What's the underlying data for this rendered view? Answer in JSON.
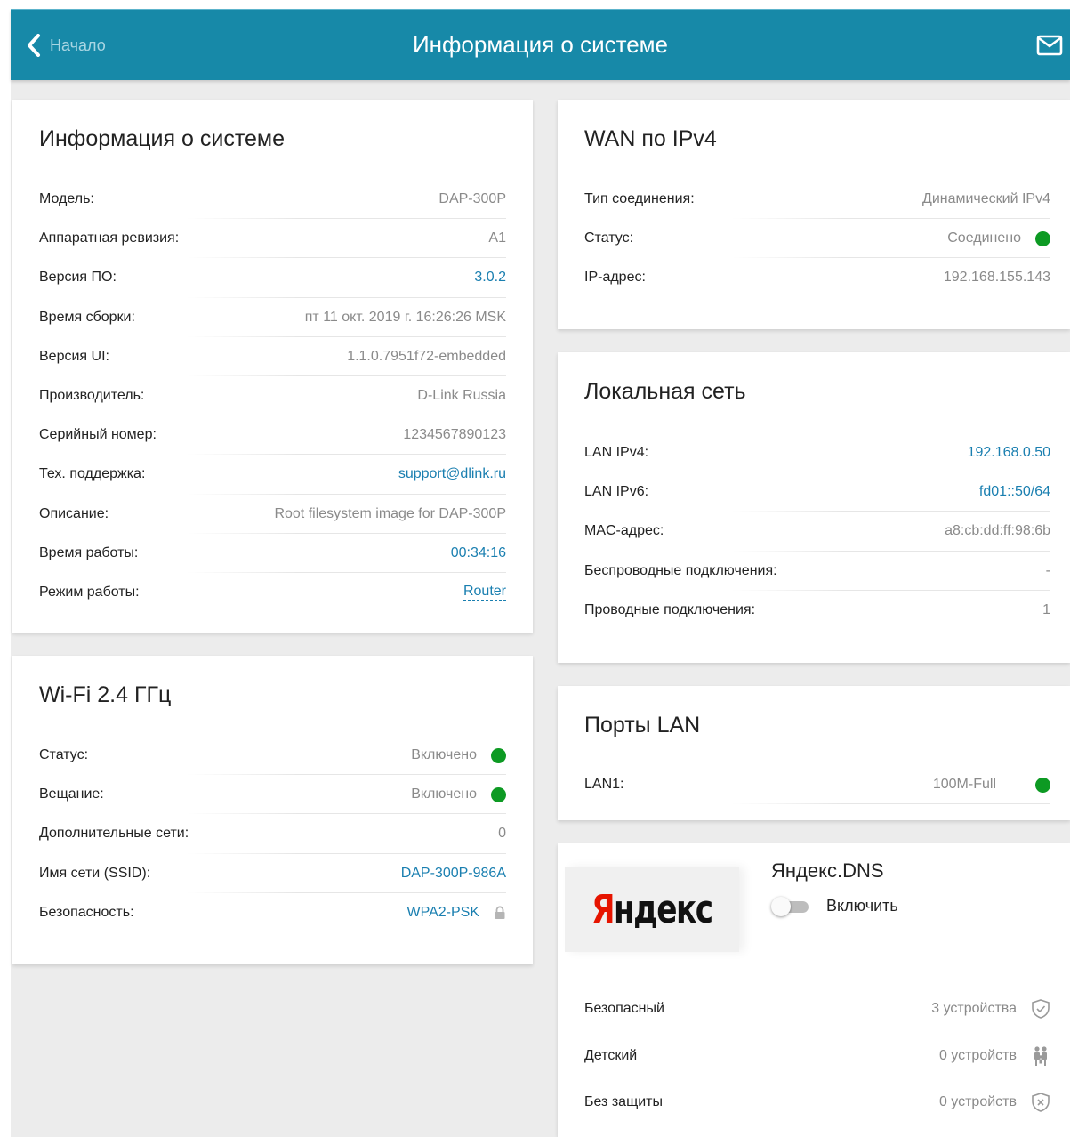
{
  "header": {
    "back_label": "Начало",
    "title": "Информация о системе"
  },
  "system_info": {
    "title": "Информация о системе",
    "rows": [
      {
        "label": "Модель:",
        "value": "DAP-300P"
      },
      {
        "label": "Аппаратная ревизия:",
        "value": "A1"
      },
      {
        "label": "Версия ПО:",
        "value": "3.0.2"
      },
      {
        "label": "Время сборки:",
        "value": "пт 11 окт. 2019 г. 16:26:26 MSK"
      },
      {
        "label": "Версия UI:",
        "value": "1.1.0.7951f72-embedded"
      },
      {
        "label": "Производитель:",
        "value": "D-Link Russia"
      },
      {
        "label": "Серийный номер:",
        "value": "1234567890123"
      },
      {
        "label": "Тех. поддержка:",
        "value": "support@dlink.ru"
      },
      {
        "label": "Описание:",
        "value": "Root filesystem image for DAP-300P"
      },
      {
        "label": "Время работы:",
        "value": "00:34:16"
      },
      {
        "label": "Режим работы:",
        "value": "Router"
      }
    ]
  },
  "wifi": {
    "title": "Wi-Fi 2.4 ГГц",
    "rows": [
      {
        "label": "Статус:",
        "value": "Включено"
      },
      {
        "label": "Вещание:",
        "value": "Включено"
      },
      {
        "label": "Дополнительные сети:",
        "value": "0"
      },
      {
        "label": "Имя сети (SSID):",
        "value": "DAP-300P-986A"
      },
      {
        "label": "Безопасность:",
        "value": "WPA2-PSK"
      }
    ]
  },
  "wan": {
    "title": "WAN по IPv4",
    "rows": [
      {
        "label": "Тип соединения:",
        "value": "Динамический IPv4"
      },
      {
        "label": "Статус:",
        "value": "Соединено"
      },
      {
        "label": "IP-адрес:",
        "value": "192.168.155.143"
      }
    ]
  },
  "lan": {
    "title": "Локальная сеть",
    "rows": [
      {
        "label": "LAN IPv4:",
        "value": "192.168.0.50"
      },
      {
        "label": "LAN IPv6:",
        "value": "fd01::50/64"
      },
      {
        "label": "MAC-адрес:",
        "value": "a8:cb:dd:ff:98:6b"
      },
      {
        "label": "Беспроводные подключения:",
        "value": "-"
      },
      {
        "label": "Проводные подключения:",
        "value": "1"
      }
    ]
  },
  "ports": {
    "title": "Порты LAN",
    "rows": [
      {
        "label": "LAN1:",
        "value": "100M-Full"
      }
    ]
  },
  "yandex": {
    "logo_first": "Я",
    "logo_rest": "ндекс",
    "title": "Яндекс.DNS",
    "toggle_label": "Включить",
    "enabled": false,
    "rows": [
      {
        "label": "Безопасный",
        "value": "3 устройства"
      },
      {
        "label": "Детский",
        "value": "0 устройств"
      },
      {
        "label": "Без защиты",
        "value": "0 устройств"
      }
    ]
  },
  "colors": {
    "header": "#1789a8",
    "link": "#1a7fb0",
    "status_ok": "#0d9a23",
    "logo_red": "#e61400"
  }
}
